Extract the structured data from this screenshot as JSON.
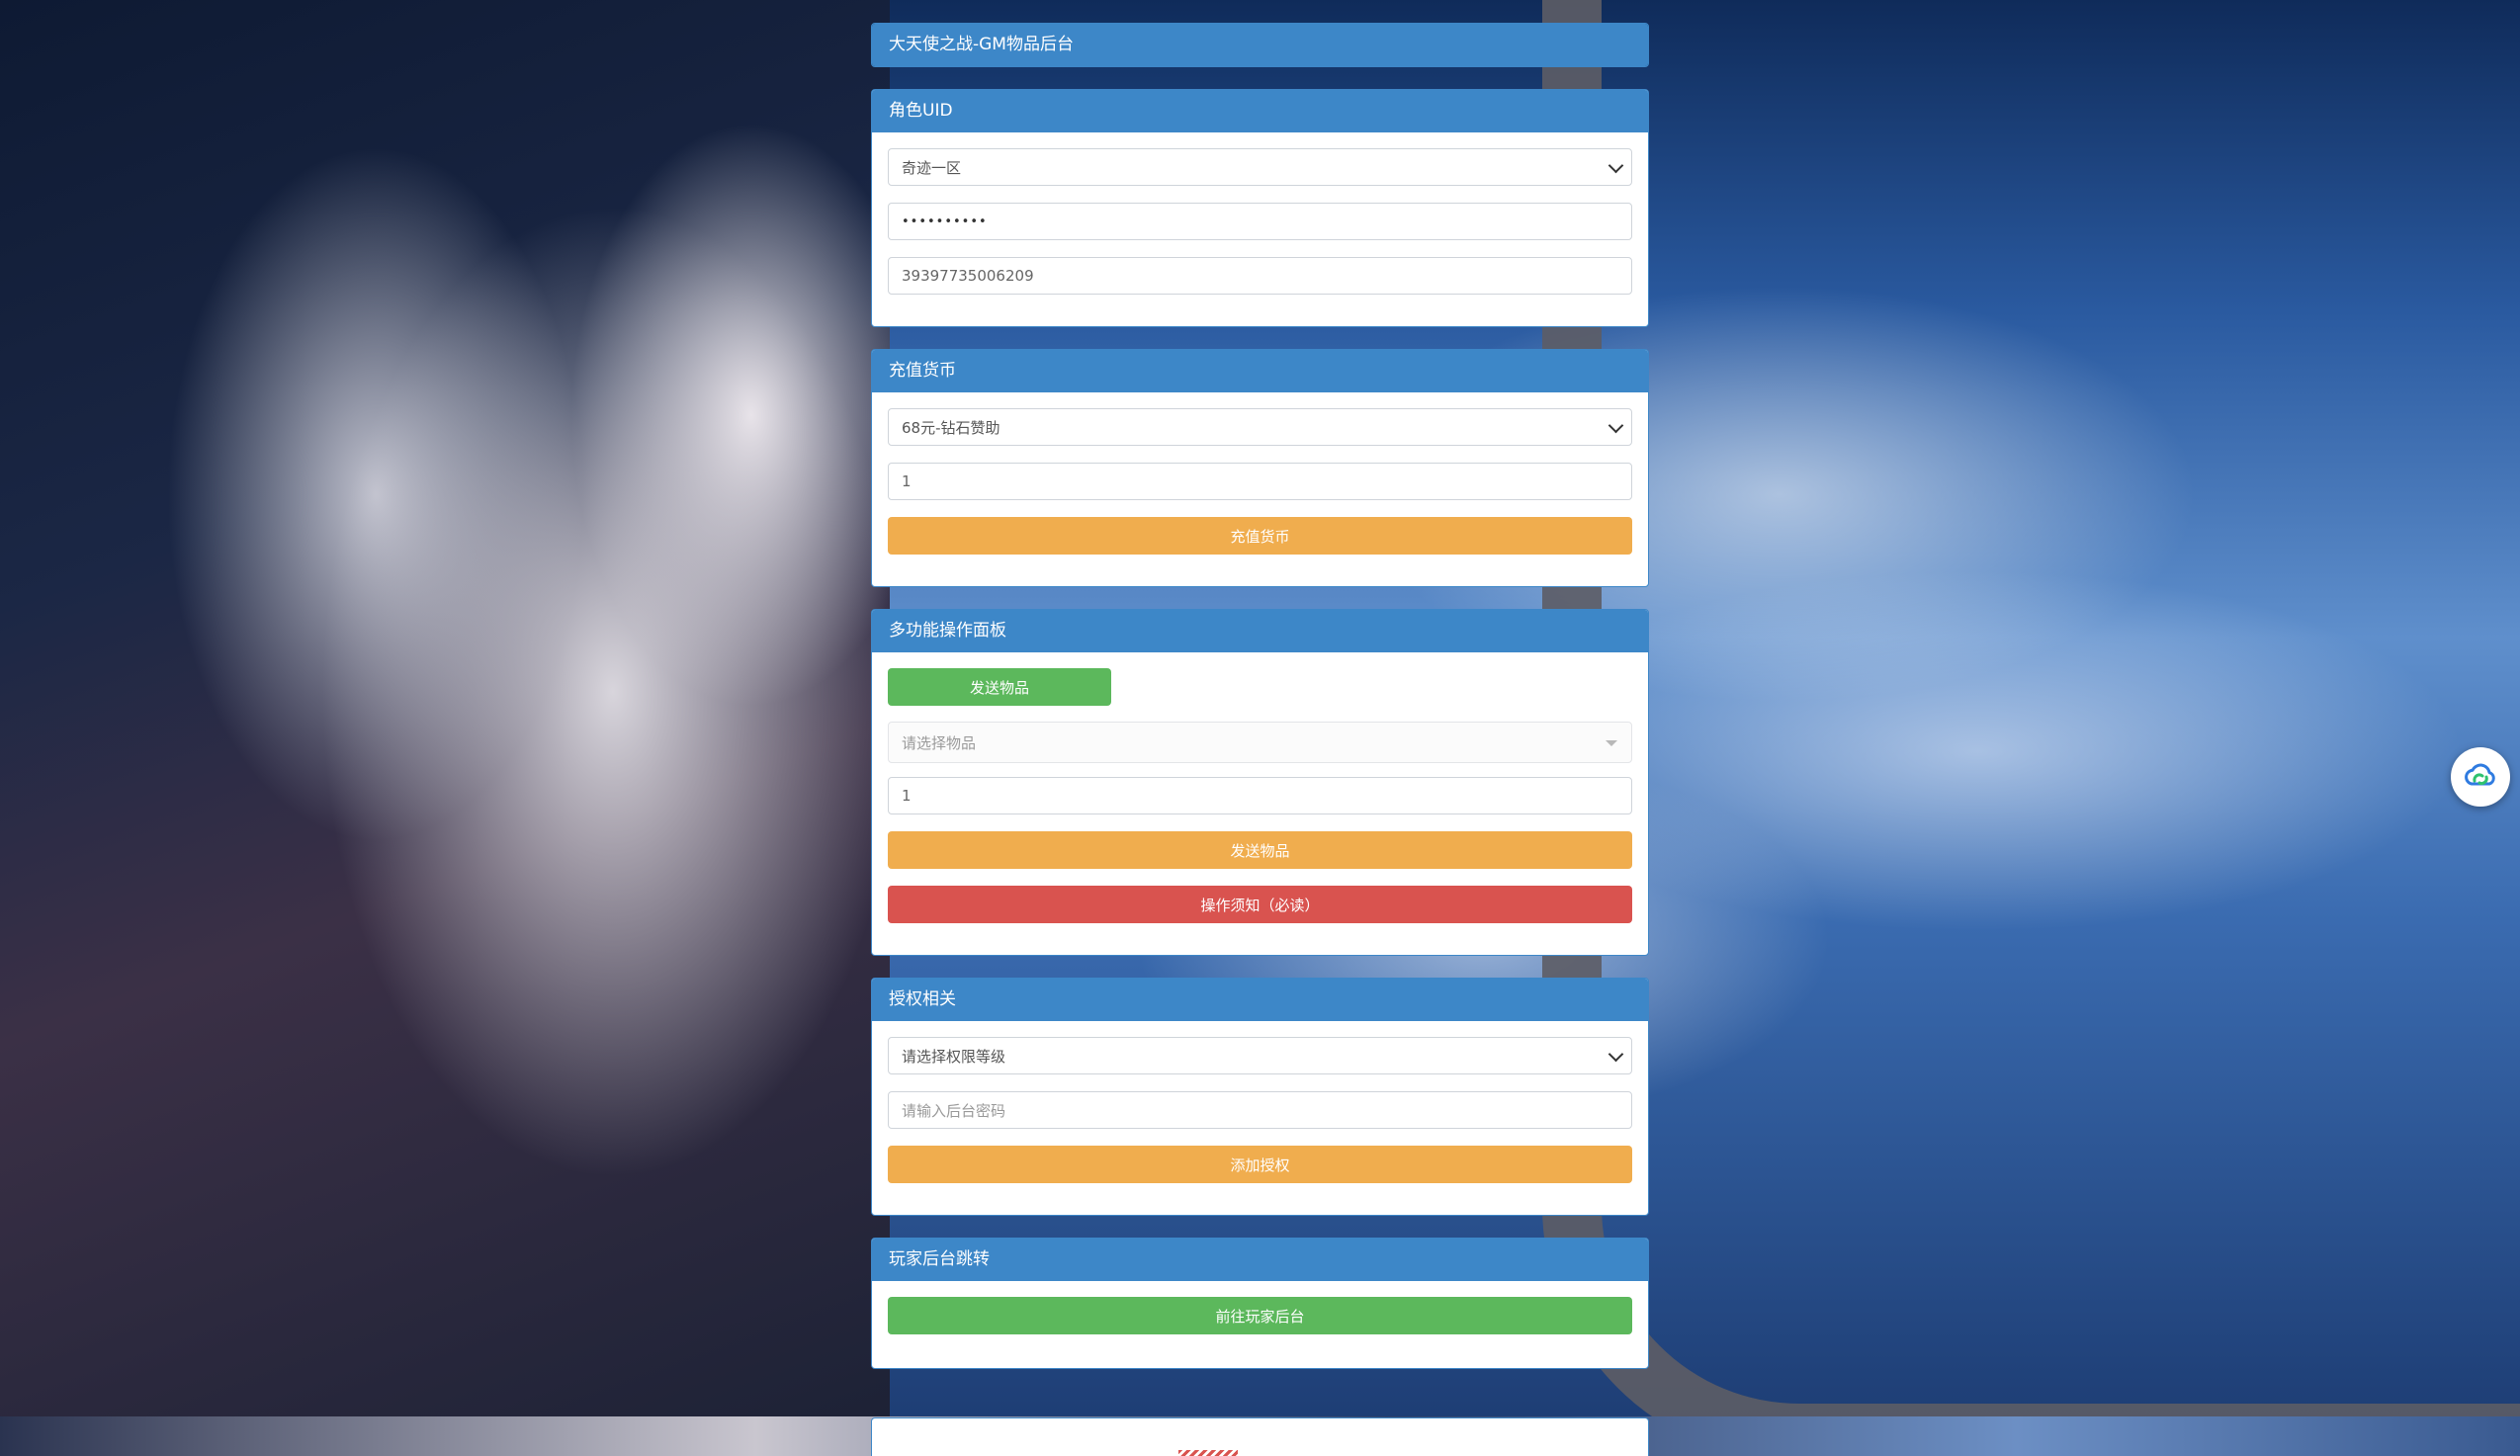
{
  "app_title": "大天使之战-GM物品后台",
  "role_panel": {
    "title": "角色UID",
    "server_select": "奇迹一区",
    "password_mask": "••••••••••",
    "uid_value": "39397735006209"
  },
  "recharge_panel": {
    "title": "充值货币",
    "package_select": "68元-钻石赞助",
    "quantity_value": "1",
    "submit_label": "充值货币"
  },
  "multi_panel": {
    "title": "多功能操作面板",
    "send_tab_label": "发送物品",
    "item_select_placeholder": "请选择物品",
    "quantity_value": "1",
    "send_button_label": "发送物品",
    "notice_button_label": "操作须知（必读）"
  },
  "auth_panel": {
    "title": "授权相关",
    "level_select": "请选择权限等级",
    "password_placeholder": "请输入后台密码",
    "add_button_label": "添加授权"
  },
  "player_panel": {
    "title": "玩家后台跳转",
    "goto_button_label": "前往玩家后台"
  },
  "colors": {
    "panel_header": "#3d87c8",
    "warning": "#f0ad4e",
    "danger": "#d9534f",
    "success": "#5cb85c"
  },
  "icons": {
    "side_float": "cloud-sync-icon"
  }
}
